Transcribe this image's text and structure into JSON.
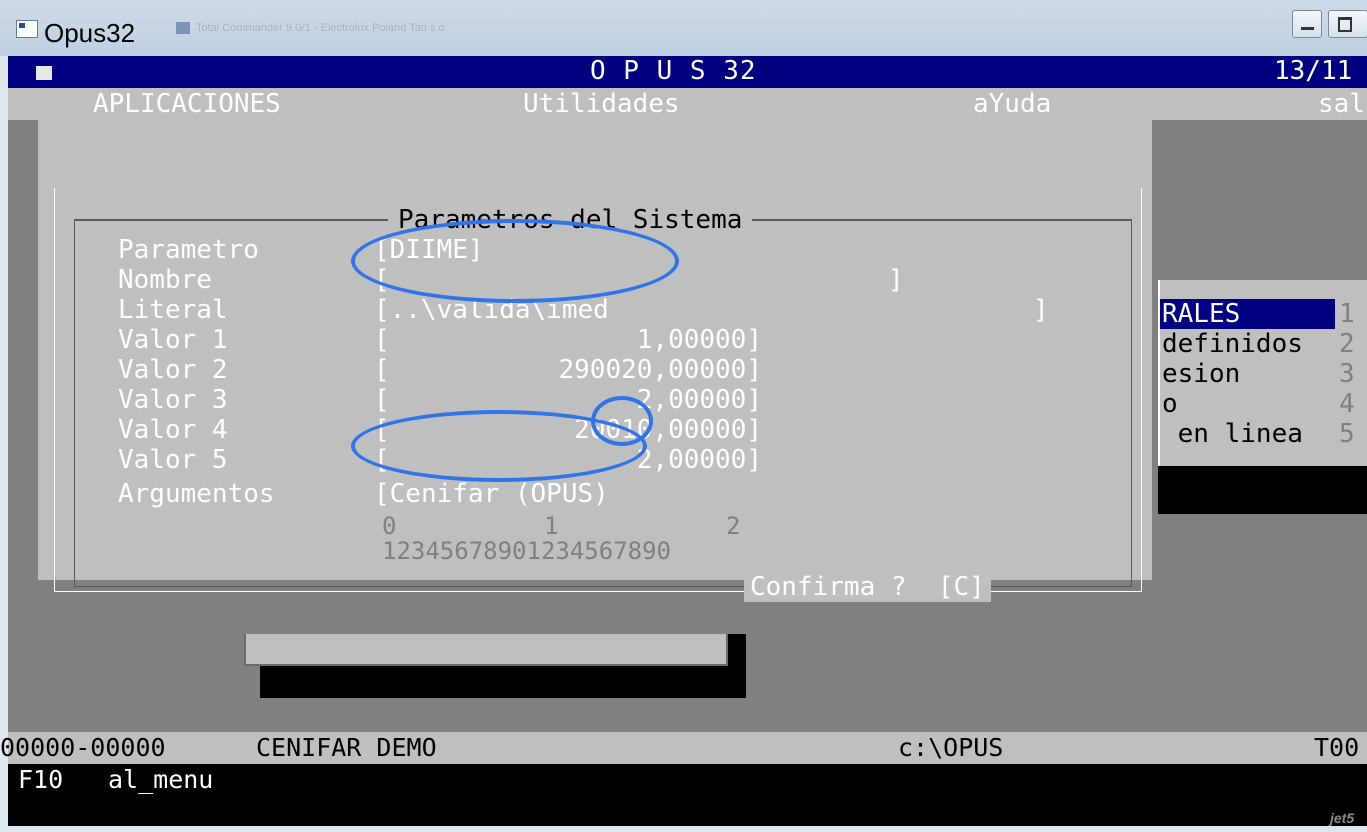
{
  "window": {
    "title": "Opus32",
    "background_tab": "Total Commander 9.0⁄⁄1 - Electrolux Poland Tau s.o."
  },
  "console": {
    "app_title": "O P U S 32",
    "date": "13/11",
    "menu": {
      "apps": "APLICACIONES",
      "utils": "Utilidades",
      "help": "aYuda",
      "exit": "sal"
    },
    "dialog": {
      "title": "Parametros del Sistema",
      "fields": {
        "parametro": {
          "label": "Parametro",
          "value": "[DIIME]"
        },
        "nombre": {
          "label": "Nombre",
          "open": "[",
          "close": "]"
        },
        "literal": {
          "label": "Literal",
          "value": "[..\\valida\\imed",
          "close": "]"
        },
        "valor1": {
          "label": "Valor 1",
          "open": "[",
          "value": "1,00000]"
        },
        "valor2": {
          "label": "Valor 2",
          "open": "[",
          "value": "290020,00000]"
        },
        "valor3": {
          "label": "Valor 3",
          "open": "[",
          "value": "2,00000]"
        },
        "valor4": {
          "label": "Valor 4",
          "open": "[",
          "value": "20010,00000]"
        },
        "valor5": {
          "label": "Valor 5",
          "open": "[",
          "value": "2,00000]"
        },
        "argumentos": {
          "label": "Argumentos",
          "value": "[Cenifar (OPUS)"
        }
      },
      "ruler": {
        "tens": [
          "0",
          "1",
          "2"
        ],
        "units": "12345678901234567890"
      },
      "confirm": "Confirma ?  [C]"
    },
    "side_menu": [
      {
        "label": "RALES",
        "num": "1",
        "selected": true
      },
      {
        "label": "definidos",
        "num": "2"
      },
      {
        "label": "esion",
        "num": "3"
      },
      {
        "label": "o",
        "num": "4"
      },
      {
        "label": " en linea",
        "num": "5"
      }
    ],
    "status": {
      "range": "00000-00000",
      "company": "CENIFAR DEMO",
      "path": "c:\\OPUS",
      "code": "T00"
    },
    "keys": {
      "key": "F10",
      "action": "al_menu"
    }
  },
  "colors": {
    "title_bar": "#000080",
    "dialog_bg": "#bfbfbf",
    "screen_bg": "#808080",
    "annotation": "#2f74e8"
  },
  "watermark": "jet5"
}
